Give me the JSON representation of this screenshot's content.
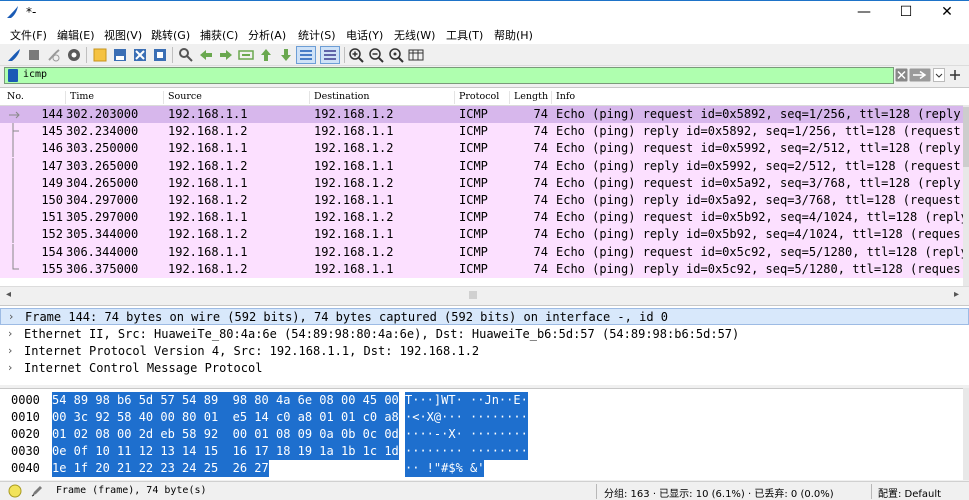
{
  "window": {
    "title": "*-",
    "minimize": "—",
    "maximize": "☐",
    "close": "✕"
  },
  "menu": [
    "文件(F)",
    "编辑(E)",
    "视图(V)",
    "跳转(G)",
    "捕获(C)",
    "分析(A)",
    "统计(S)",
    "电话(Y)",
    "无线(W)",
    "工具(T)",
    "帮助(H)"
  ],
  "filter": {
    "value": "icmp",
    "bg_color": "#afffaf"
  },
  "columns": [
    "No.",
    "Time",
    "Source",
    "Destination",
    "Protocol",
    "Length",
    "Info"
  ],
  "packets": [
    {
      "no": "144",
      "time": "302.203000",
      "src": "192.168.1.1",
      "dst": "192.168.1.2",
      "proto": "ICMP",
      "len": "74",
      "info": "Echo (ping) request  id=0x5892, seq=1/256, ttl=128 (reply i"
    },
    {
      "no": "145",
      "time": "302.234000",
      "src": "192.168.1.2",
      "dst": "192.168.1.1",
      "proto": "ICMP",
      "len": "74",
      "info": "Echo (ping) reply    id=0x5892, seq=1/256, ttl=128 (request"
    },
    {
      "no": "146",
      "time": "303.250000",
      "src": "192.168.1.1",
      "dst": "192.168.1.2",
      "proto": "ICMP",
      "len": "74",
      "info": "Echo (ping) request  id=0x5992, seq=2/512, ttl=128 (reply i"
    },
    {
      "no": "147",
      "time": "303.265000",
      "src": "192.168.1.2",
      "dst": "192.168.1.1",
      "proto": "ICMP",
      "len": "74",
      "info": "Echo (ping) reply    id=0x5992, seq=2/512, ttl=128 (request"
    },
    {
      "no": "149",
      "time": "304.265000",
      "src": "192.168.1.1",
      "dst": "192.168.1.2",
      "proto": "ICMP",
      "len": "74",
      "info": "Echo (ping) request  id=0x5a92, seq=3/768, ttl=128 (reply i"
    },
    {
      "no": "150",
      "time": "304.297000",
      "src": "192.168.1.2",
      "dst": "192.168.1.1",
      "proto": "ICMP",
      "len": "74",
      "info": "Echo (ping) reply    id=0x5a92, seq=3/768, ttl=128 (request"
    },
    {
      "no": "151",
      "time": "305.297000",
      "src": "192.168.1.1",
      "dst": "192.168.1.2",
      "proto": "ICMP",
      "len": "74",
      "info": "Echo (ping) request  id=0x5b92, seq=4/1024, ttl=128 (reply"
    },
    {
      "no": "152",
      "time": "305.344000",
      "src": "192.168.1.2",
      "dst": "192.168.1.1",
      "proto": "ICMP",
      "len": "74",
      "info": "Echo (ping) reply    id=0x5b92, seq=4/1024, ttl=128 (reques"
    },
    {
      "no": "154",
      "time": "306.344000",
      "src": "192.168.1.1",
      "dst": "192.168.1.2",
      "proto": "ICMP",
      "len": "74",
      "info": "Echo (ping) request  id=0x5c92, seq=5/1280, ttl=128 (reply"
    },
    {
      "no": "155",
      "time": "306.375000",
      "src": "192.168.1.2",
      "dst": "192.168.1.1",
      "proto": "ICMP",
      "len": "74",
      "info": "Echo (ping) reply    id=0x5c92, seq=5/1280, ttl=128 (reques"
    }
  ],
  "details": [
    "Frame 144: 74 bytes on wire (592 bits), 74 bytes captured (592 bits) on interface -, id 0",
    "Ethernet II, Src: HuaweiTe_80:4a:6e (54:89:98:80:4a:6e), Dst: HuaweiTe_b6:5d:57 (54:89:98:b6:5d:57)",
    "Internet Protocol Version 4, Src: 192.168.1.1, Dst: 192.168.1.2",
    "Internet Control Message Protocol"
  ],
  "bytes": [
    {
      "off": "0000",
      "hex": "54 89 98 b6 5d 57 54 89  98 80 4a 6e 08 00 45 00",
      "ascii": "T···]WT· ··Jn··E·"
    },
    {
      "off": "0010",
      "hex": "00 3c 92 58 40 00 80 01  e5 14 c0 a8 01 01 c0 a8",
      "ascii": "·<·X@··· ········"
    },
    {
      "off": "0020",
      "hex": "01 02 08 00 2d eb 58 92  00 01 08 09 0a 0b 0c 0d",
      "ascii": "····-·X· ········"
    },
    {
      "off": "0030",
      "hex": "0e 0f 10 11 12 13 14 15  16 17 18 19 1a 1b 1c 1d",
      "ascii": "········ ········"
    },
    {
      "off": "0040",
      "hex": "1e 1f 20 21 22 23 24 25  26 27",
      "ascii": "·· !\"#$% &'"
    }
  ],
  "status": {
    "frame": "Frame (frame), 74 byte(s)",
    "counts": "分组: 163 · 已显示: 10 (6.1%) · 已丢弃: 0 (0.0%)",
    "profile": "配置: Default"
  },
  "colors": {
    "row_bg": "#fce0ff",
    "row_selected": "#d7b7ec",
    "bytes_highlight": "#1e6fce",
    "detail_selected": "#d8e8fb"
  }
}
